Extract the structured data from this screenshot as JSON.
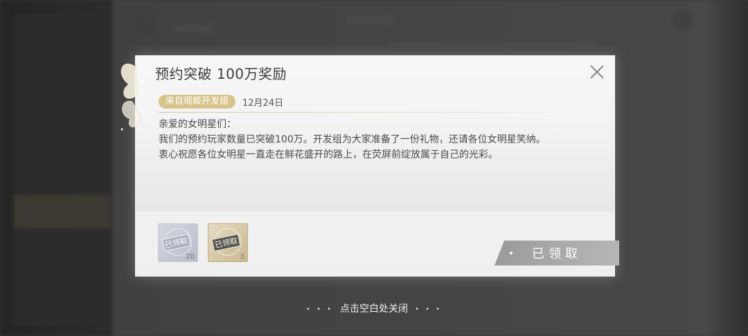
{
  "dialog": {
    "title": "预约突破 100万奖励",
    "sender": "来自瑶姬开发组",
    "date": "12月24日",
    "body": [
      "亲爱的女明星们：",
      "我们的预约玩家数量已突破100万。开发组为大家准备了一份礼物，还请各位女明星笑纳。",
      "衷心祝愿各位女明星一直走在鲜花盛开的路上，在荧屏前绽放属于自己的光彩。"
    ],
    "rewards": [
      {
        "stamp": "已领取",
        "count": "20",
        "style": "silver"
      },
      {
        "stamp": "已领取",
        "count": "3",
        "style": "gold"
      }
    ],
    "claim_button": "已领取"
  },
  "hint": "点击空白处关闭",
  "colors": {
    "sender_badge": "#d8c48a",
    "dialog_bg": "#f3f3f3",
    "button_bg": "#a8a8a8"
  },
  "icons": {
    "close": "close-icon",
    "decoration": "butterfly-wing-decoration"
  }
}
